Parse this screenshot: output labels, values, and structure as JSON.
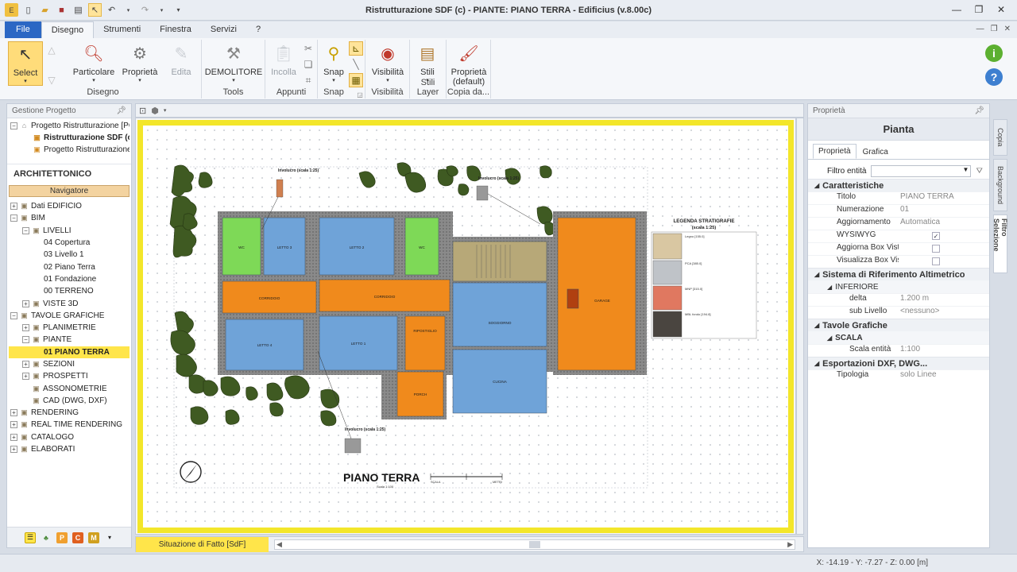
{
  "app": {
    "window_title": "Ristrutturazione SDF (c) -  PIANTE: PIANO TERRA - Edificius (v.8.00c)"
  },
  "menu_tabs": [
    "File",
    "Disegno",
    "Strumenti",
    "Finestra",
    "Servizi",
    "?"
  ],
  "ribbon": {
    "disegno_group": {
      "title": "Disegno",
      "select": "Select",
      "particolare": "Particolare",
      "proprieta": "Proprietà",
      "edita": "Edita"
    },
    "tools_group": {
      "title": "Tools",
      "demolitore": "DEMOLITORE"
    },
    "appunti_group": {
      "title": "Appunti",
      "incolla": "Incolla"
    },
    "snap_group": {
      "title": "Snap",
      "snap": "Snap"
    },
    "visibilita_group": {
      "title": "Visibilità",
      "visibilita": "Visibilità"
    },
    "stili_group": {
      "title": "Stili Layer",
      "stili": "Stili"
    },
    "copia_group": {
      "title": "Copia da...",
      "proprieta_default_1": "Proprietà",
      "proprieta_default_2": "(default)"
    }
  },
  "left_panel": {
    "header": "Gestione Progetto",
    "project_tree": [
      {
        "label": "Progetto Ristrutturazione [PG]",
        "bold": false,
        "indent": 0
      },
      {
        "label": "Ristrutturazione SDF (c)",
        "bold": true,
        "indent": 1
      },
      {
        "label": "Progetto Ristrutturazione [",
        "bold": false,
        "indent": 1
      }
    ],
    "section_title": "ARCHITETTONICO",
    "navigator_button": "Navigatore",
    "nav_tree": [
      {
        "label": "Dati EDIFICIO",
        "indent": 0,
        "exp": "+",
        "icon": "building-icon"
      },
      {
        "label": "BIM",
        "indent": 0,
        "exp": "-",
        "icon": "bim-icon"
      },
      {
        "label": "LIVELLI",
        "indent": 1,
        "exp": "-",
        "icon": "levels-icon"
      },
      {
        "label": "04 Copertura",
        "indent": 2,
        "exp": "",
        "icon": ""
      },
      {
        "label": "03 Livello 1",
        "indent": 2,
        "exp": "",
        "icon": ""
      },
      {
        "label": "02 Piano Terra",
        "indent": 2,
        "exp": "",
        "icon": ""
      },
      {
        "label": "01 Fondazione",
        "indent": 2,
        "exp": "",
        "icon": ""
      },
      {
        "label": "00 TERRENO",
        "indent": 2,
        "exp": "",
        "icon": ""
      },
      {
        "label": "VISTE 3D",
        "indent": 1,
        "exp": "+",
        "icon": "views-3d-icon"
      },
      {
        "label": "TAVOLE GRAFICHE",
        "indent": 0,
        "exp": "-",
        "icon": "sheets-icon"
      },
      {
        "label": "PLANIMETRIE",
        "indent": 1,
        "exp": "+",
        "icon": "plan-icon"
      },
      {
        "label": "PIANTE",
        "indent": 1,
        "exp": "-",
        "icon": "plan-icon"
      },
      {
        "label": "01 PIANO TERRA",
        "indent": 2,
        "exp": "",
        "icon": "",
        "selected": true
      },
      {
        "label": "SEZIONI",
        "indent": 1,
        "exp": "+",
        "icon": "section-icon"
      },
      {
        "label": "PROSPETTI",
        "indent": 1,
        "exp": "+",
        "icon": "elevation-icon"
      },
      {
        "label": "ASSONOMETRIE",
        "indent": 1,
        "exp": "",
        "icon": "axo-icon"
      },
      {
        "label": "CAD (DWG, DXF)",
        "indent": 1,
        "exp": "",
        "icon": "cad-icon"
      },
      {
        "label": "RENDERING",
        "indent": 0,
        "exp": "+",
        "icon": "rendering-icon"
      },
      {
        "label": "REAL TIME RENDERING",
        "indent": 0,
        "exp": "+",
        "icon": "realtime-icon"
      },
      {
        "label": "CATALOGO",
        "indent": 0,
        "exp": "+",
        "icon": "catalog-icon"
      },
      {
        "label": "ELABORATI",
        "indent": 0,
        "exp": "+",
        "icon": "reports-icon"
      }
    ]
  },
  "canvas": {
    "layer_tab": "Situazione di Fatto  [SdF]",
    "plan_title": "PIANO TERRA",
    "plan_scale": "Scala 1:100",
    "scalebar_left": "SCALA",
    "scalebar_right": "METRI",
    "legend_title": "LEGENDA STRATIGRAFIE",
    "legend_scale": "(scala 1:25)",
    "callout_title": "Involucro (scala 1:25)",
    "legend_items": [
      {
        "name": "Legno [155.0]"
      },
      {
        "name": "PCA [385.0]"
      },
      {
        "name": "MNP [315.0]"
      },
      {
        "name": "MBL fondo [194.8]"
      }
    ],
    "rooms": {
      "wc1": "WC",
      "letto3": "LETTO 3",
      "letto2": "LETTO 2",
      "wc2": "WC",
      "corridoio1": "CORRIDOIO",
      "corridoio2": "CORRIDOIO",
      "letto4": "LETTO 4",
      "letto1": "LETTO 1",
      "ripostiglio": "RIPOSTIGLIO",
      "soggiorno": "SOGGIORNO",
      "cucina": "CUCINA",
      "porch": "PORCH",
      "garage": "GARAGE"
    }
  },
  "right_panel": {
    "header": "Proprietà",
    "title": "Pianta",
    "tabs": [
      "Proprietà",
      "Grafica"
    ],
    "filter_label": "Filtro entità",
    "sections": {
      "caratteristiche": "Caratteristiche",
      "sistema": "Sistema di Riferimento Altimetrico",
      "inferiore": "INFERIORE",
      "tavole": "Tavole Grafiche",
      "scala": "SCALA",
      "esportazioni": "Esportazioni DXF, DWG..."
    },
    "props": {
      "titolo": {
        "k": "Titolo",
        "v": "PIANO TERRA"
      },
      "numerazione": {
        "k": "Numerazione",
        "v": "01"
      },
      "aggiornamento": {
        "k": "Aggiornamento",
        "v": "Automatica"
      },
      "wysiwyg": {
        "k": "WYSIWYG",
        "checked": true
      },
      "aggiorna_box": {
        "k": "Aggiorna Box Vista",
        "checked": false
      },
      "visualizza_box": {
        "k": "Visualizza Box Vista",
        "checked": false
      },
      "delta": {
        "k": "delta",
        "v": "1.200 m"
      },
      "sub_livello": {
        "k": "sub Livello",
        "v": "<nessuno>"
      },
      "scala_entita": {
        "k": "Scala entità",
        "v": "1:100"
      },
      "tipologia": {
        "k": "Tipologia",
        "v": "solo Linee"
      }
    }
  },
  "side_tabs": [
    "Copia",
    "Background",
    "Filtro Selezione"
  ],
  "status": {
    "coords": "X: -14.19 - Y: -7.27 - Z: 0.00 [m]"
  },
  "colors": {
    "accent_yellow": "#f3e62a",
    "room_blue": "#6fa3d8",
    "room_orange": "#f08a1c",
    "room_green": "#7ed957",
    "file_tab": "#2b67c4"
  }
}
